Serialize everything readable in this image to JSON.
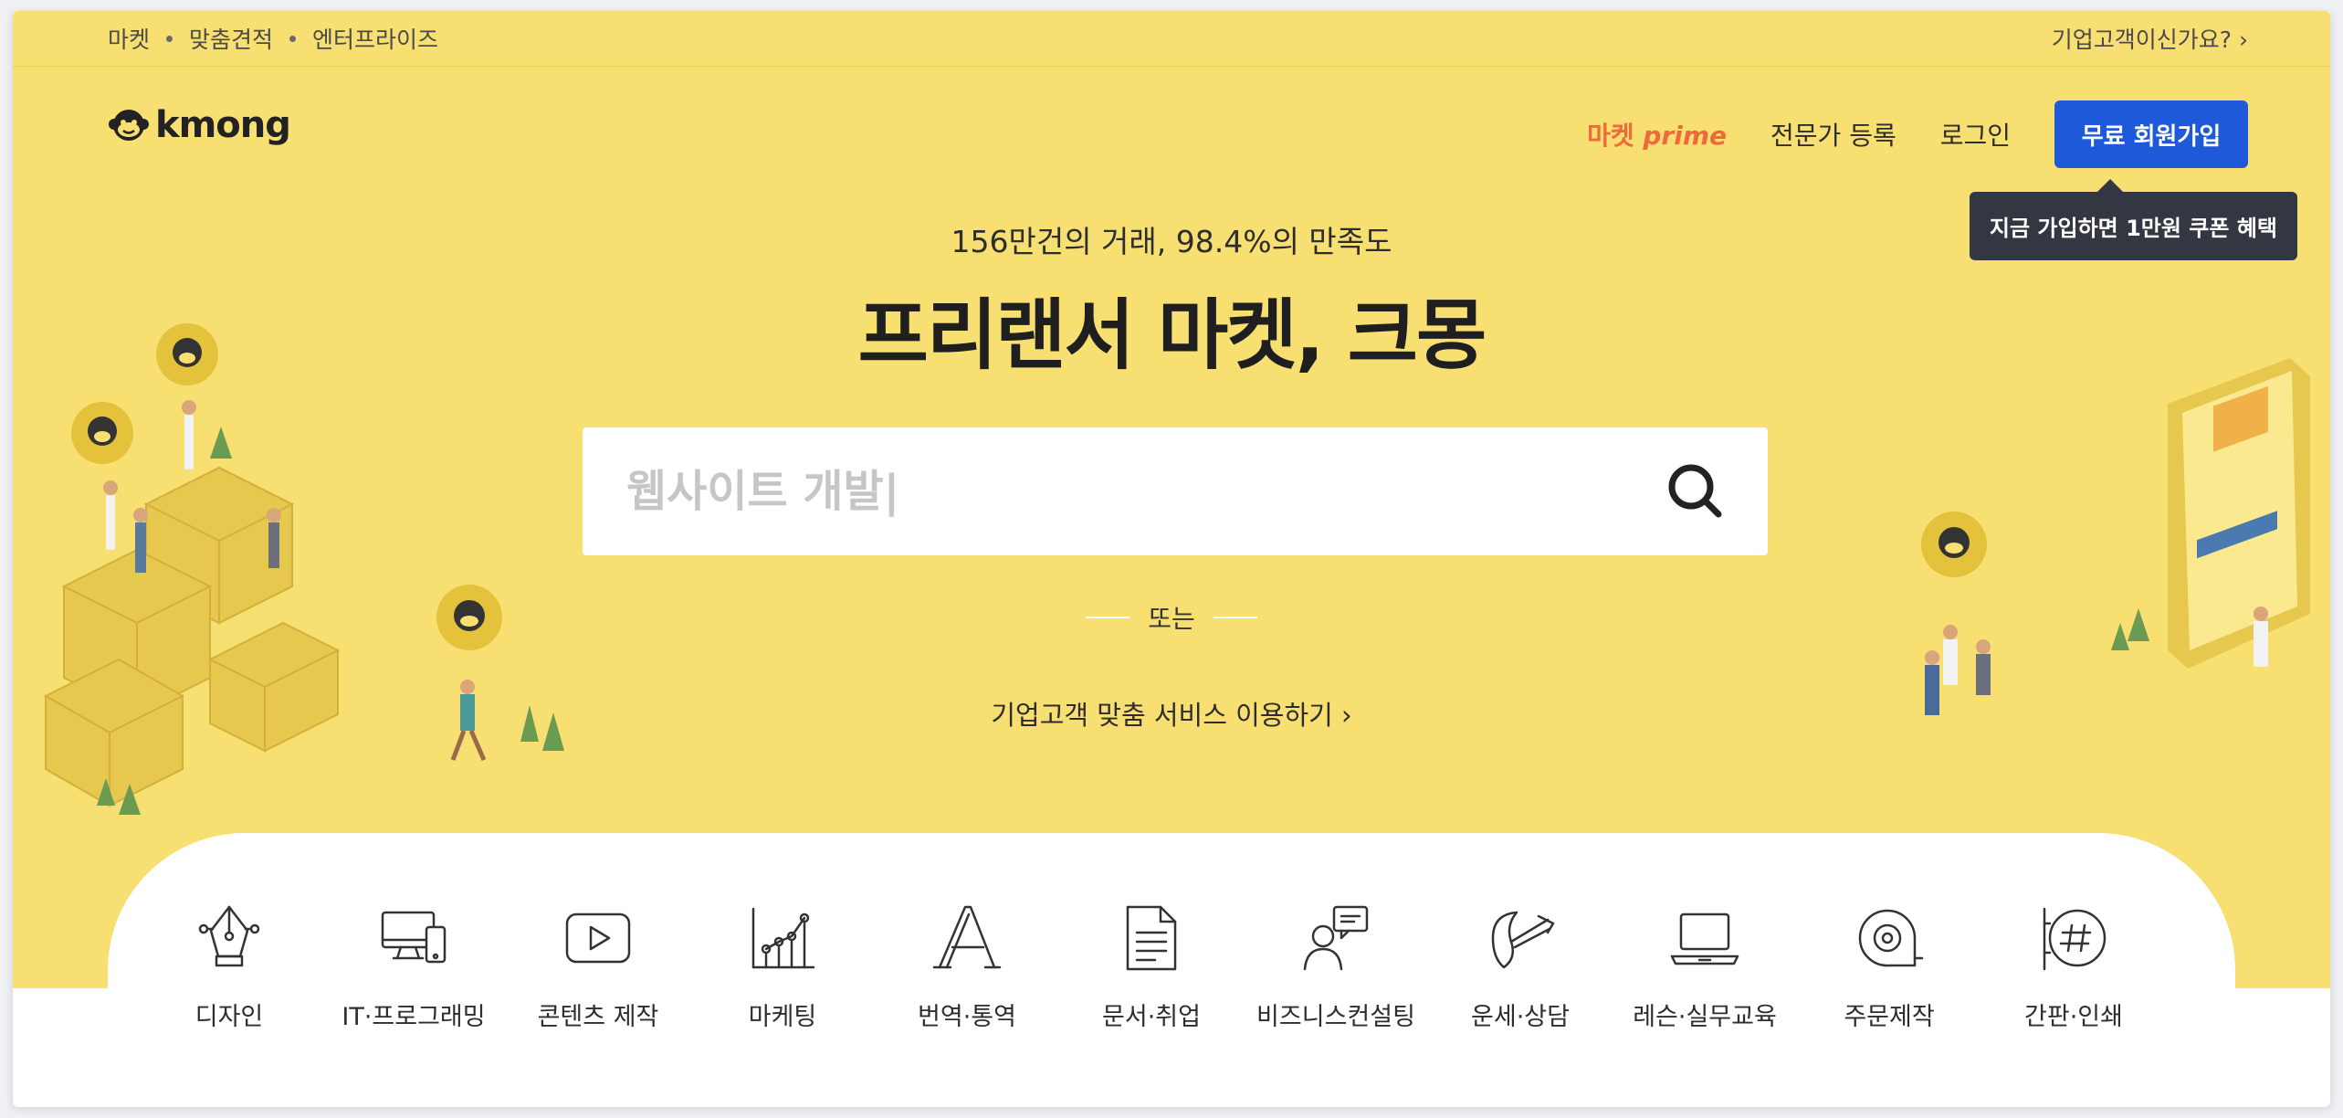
{
  "top_links": [
    "마켓",
    "맞춤견적",
    "엔터프라이즈"
  ],
  "enterprise_question": "기업고객이신가요? ›",
  "logo_text": "kmong",
  "nav": {
    "prime_market": "마켓",
    "prime_label": "prime",
    "expert_register": "전문가 등록",
    "login": "로그인",
    "signup": "무료 회원가입"
  },
  "tooltip": "지금 가입하면 1만원 쿠폰 혜택",
  "hero": {
    "subtitle": "156만건의 거래, 98.4%의 만족도",
    "title": "프리랜서 마켓, 크몽"
  },
  "search": {
    "placeholder": "웹사이트 개발|"
  },
  "or_label": "또는",
  "business_link": "기업고객 맞춤 서비스 이용하기 ›",
  "categories": [
    {
      "label": "디자인",
      "icon": "pen-nib-icon"
    },
    {
      "label": "IT·프로그래밍",
      "icon": "devices-icon"
    },
    {
      "label": "콘텐츠 제작",
      "icon": "play-icon"
    },
    {
      "label": "마케팅",
      "icon": "chart-icon"
    },
    {
      "label": "번역·통역",
      "icon": "letter-a-icon"
    },
    {
      "label": "문서·취업",
      "icon": "document-icon"
    },
    {
      "label": "비즈니스컨설팅",
      "icon": "consulting-icon"
    },
    {
      "label": "운세·상담",
      "icon": "fortune-icon"
    },
    {
      "label": "레슨·실무교육",
      "icon": "laptop-icon"
    },
    {
      "label": "주문제작",
      "icon": "tape-icon"
    },
    {
      "label": "간판·인쇄",
      "icon": "sign-icon"
    }
  ],
  "colors": {
    "hero_bg": "#f7df72",
    "primary_blue": "#1d59d8",
    "prime_orange": "#ef6a3a",
    "tooltip_bg": "#333742"
  }
}
